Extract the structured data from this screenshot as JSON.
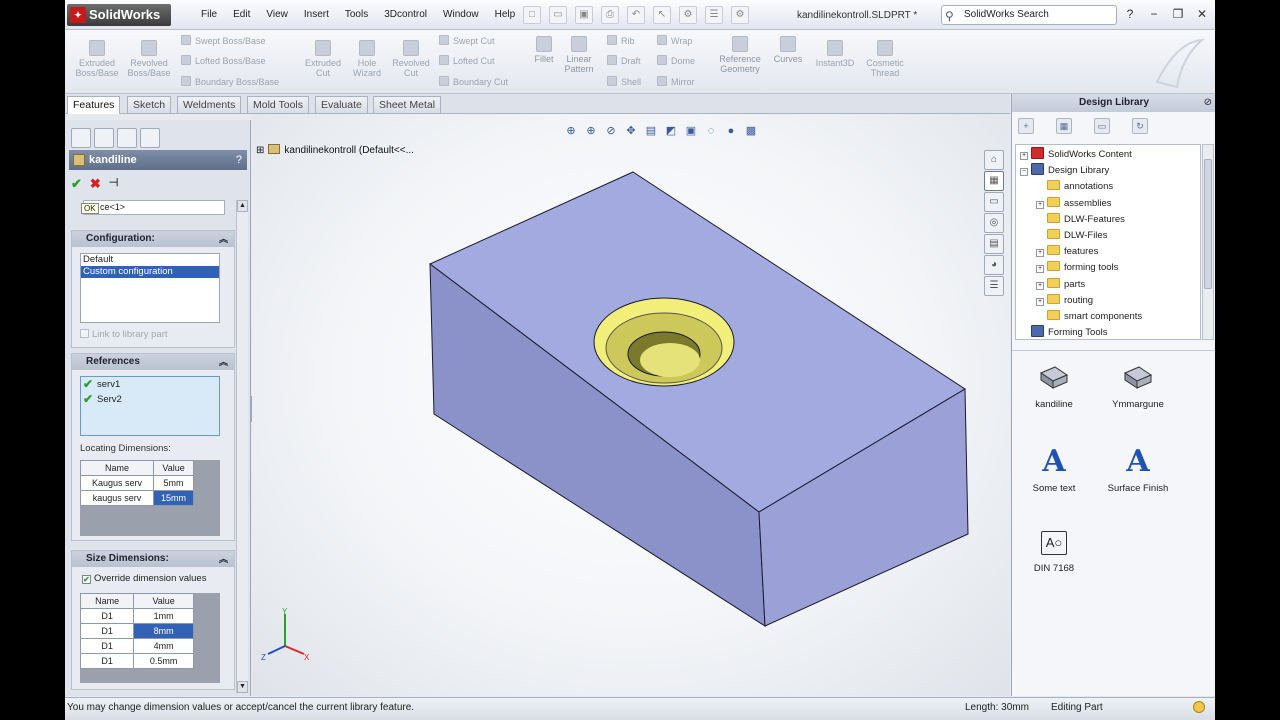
{
  "titlebar": {
    "brand": "SolidWorks",
    "menu": [
      "File",
      "Edit",
      "View",
      "Insert",
      "Tools",
      "3Dcontrol",
      "Window",
      "Help"
    ],
    "document_title": "kandilinekontroll.SLDPRT *",
    "search_text": "SolidWorks Search",
    "help": "?",
    "minimize": "−",
    "restore": "❐",
    "close": "✕"
  },
  "command_manager": {
    "tools": [
      {
        "name": "extruded-boss",
        "label1": "Extruded",
        "label2": "Boss/Base"
      },
      {
        "name": "revolved-boss",
        "label1": "Revolved",
        "label2": "Boss/Base"
      },
      {
        "name": "extruded-cut",
        "label1": "Extruded",
        "label2": "Cut"
      },
      {
        "name": "hole-wizard",
        "label1": "Hole",
        "label2": "Wizard"
      },
      {
        "name": "revolved-cut",
        "label1": "Revolved",
        "label2": "Cut"
      },
      {
        "name": "fillet",
        "label1": "Fillet",
        "label2": ""
      },
      {
        "name": "linear-pattern",
        "label1": "Linear",
        "label2": "Pattern"
      },
      {
        "name": "reference-geometry",
        "label1": "Reference",
        "label2": "Geometry"
      },
      {
        "name": "curves",
        "label1": "Curves",
        "label2": ""
      },
      {
        "name": "instant3d",
        "label1": "Instant3D",
        "label2": ""
      },
      {
        "name": "cosmetic-thread",
        "label1": "Cosmetic",
        "label2": "Thread"
      }
    ],
    "small_tools": {
      "swept_boss": "Swept Boss/Base",
      "lofted_boss": "Lofted Boss/Base",
      "boundary_boss": "Boundary Boss/Base",
      "swept_cut": "Swept Cut",
      "lofted_cut": "Lofted Cut",
      "boundary_cut": "Boundary Cut",
      "rib": "Rib",
      "draft": "Draft",
      "shell": "Shell",
      "wrap": "Wrap",
      "dome": "Dome",
      "mirror": "Mirror"
    }
  },
  "tabs": [
    "Features",
    "Sketch",
    "Weldments",
    "Mold Tools",
    "Evaluate",
    "Sheet Metal"
  ],
  "property_manager": {
    "title": "kandiline",
    "help": "?",
    "ok": "✔",
    "cancel": "✖",
    "pin": "⊣",
    "tooltip": "OK",
    "partial_field": "ce<1>",
    "configuration": {
      "header": "Configuration:",
      "items": [
        "Default",
        "Custom configuration"
      ],
      "link_label": "Link to library part"
    },
    "references": {
      "header": "References",
      "items": [
        "serv1",
        "Serv2"
      ],
      "locating_label": "Locating Dimensions:",
      "columns": [
        "Name",
        "Value"
      ],
      "rows": [
        [
          "Kaugus serv",
          "5mm"
        ],
        [
          "kaugus serv",
          "15mm"
        ]
      ]
    },
    "size": {
      "header": "Size Dimensions:",
      "override_label": "Override dimension values",
      "columns": [
        "Name",
        "Value"
      ],
      "rows": [
        [
          "D1",
          "1mm"
        ],
        [
          "D1",
          "8mm"
        ],
        [
          "D1",
          "4mm"
        ],
        [
          "D1",
          "0.5mm"
        ]
      ]
    }
  },
  "viewport": {
    "tree_label": "kandilinekontroll  (Default<<...",
    "axis_x": "X",
    "axis_y": "Y",
    "axis_z": "Z"
  },
  "design_library": {
    "header": "Design Library",
    "tree": [
      {
        "label": "SolidWorks Content",
        "level": 0,
        "icon": "sw",
        "pm": "+"
      },
      {
        "label": "Design Library",
        "level": 0,
        "icon": "dl",
        "pm": "−"
      },
      {
        "label": "annotations",
        "level": 1,
        "icon": "folder",
        "pm": ""
      },
      {
        "label": "assemblies",
        "level": 1,
        "icon": "folder",
        "pm": "+"
      },
      {
        "label": "DLW-Features",
        "level": 1,
        "icon": "folder",
        "pm": ""
      },
      {
        "label": "DLW-Files",
        "level": 1,
        "icon": "folder",
        "pm": ""
      },
      {
        "label": "features",
        "level": 1,
        "icon": "folder",
        "pm": "+"
      },
      {
        "label": "forming tools",
        "level": 1,
        "icon": "folder",
        "pm": "+"
      },
      {
        "label": "parts",
        "level": 1,
        "icon": "folder",
        "pm": "+"
      },
      {
        "label": "routing",
        "level": 1,
        "icon": "folder",
        "pm": "+"
      },
      {
        "label": "smart components",
        "level": 1,
        "icon": "folder",
        "pm": ""
      },
      {
        "label": "Forming Tools",
        "level": 0,
        "icon": "dl",
        "pm": ""
      }
    ],
    "items": [
      {
        "label": "kandiline",
        "icon": "block"
      },
      {
        "label": "Ymmargune",
        "icon": "block"
      },
      {
        "label": "Some text",
        "icon": "A"
      },
      {
        "label": "Surface Finish",
        "icon": "A"
      },
      {
        "label": "DIN 7168",
        "icon": "AO"
      }
    ]
  },
  "status": {
    "message": "You may change dimension values or accept/cancel the current library feature.",
    "length": "Length: 30mm",
    "mode": "Editing Part"
  },
  "colors": {
    "accent": "#3162b6",
    "part_face_top": "#a4abe0",
    "part_face_side": "#8990c8",
    "hole": "#f2ee7a"
  }
}
